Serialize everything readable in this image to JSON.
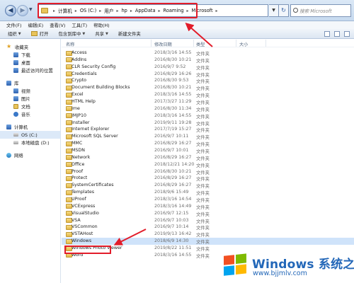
{
  "address": {
    "crumbs": [
      "计算机",
      "OS (C:)",
      "用户",
      "hp",
      "AppData",
      "Roaming",
      "Microsoft"
    ]
  },
  "search": {
    "placeholder": "搜索 Microsoft"
  },
  "menu": [
    "文件(F)",
    "编辑(E)",
    "查看(V)",
    "工具(T)",
    "帮助(H)"
  ],
  "toolbar": {
    "organize": "组织",
    "open": "打开",
    "include": "包含到库中",
    "share": "共享",
    "new_folder": "新建文件夹"
  },
  "nav": {
    "favorites": "收藏夹",
    "downloads": "下载",
    "desktop": "桌面",
    "recent": "最近访问的位置",
    "libraries": "库",
    "videos": "视频",
    "pictures": "图片",
    "documents": "文档",
    "music": "音乐",
    "computer": "计算机",
    "drive_c": "OS (C:)",
    "drive_d": "本地磁盘 (D:)",
    "network": "网络"
  },
  "columns": {
    "name": "名称",
    "date": "修改日期",
    "type": "类型",
    "size": "大小"
  },
  "files": [
    {
      "name": "Access",
      "date": "2018/3/16 14:55",
      "type": "文件夹"
    },
    {
      "name": "AddIns",
      "date": "2016/8/30 10:21",
      "type": "文件夹"
    },
    {
      "name": "CLR Security Config",
      "date": "2016/9/7 9:52",
      "type": "文件夹"
    },
    {
      "name": "Credentials",
      "date": "2016/8/29 16:26",
      "type": "文件夹"
    },
    {
      "name": "Crypto",
      "date": "2016/8/30 9:53",
      "type": "文件夹"
    },
    {
      "name": "Document Building Blocks",
      "date": "2016/8/30 10:21",
      "type": "文件夹"
    },
    {
      "name": "Excel",
      "date": "2018/3/16 14:55",
      "type": "文件夹"
    },
    {
      "name": "HTML Help",
      "date": "2017/3/27 11:29",
      "type": "文件夹"
    },
    {
      "name": "Ime",
      "date": "2016/8/30 11:34",
      "type": "文件夹"
    },
    {
      "name": "IMJP10",
      "date": "2018/3/16 14:55",
      "type": "文件夹"
    },
    {
      "name": "Installer",
      "date": "2019/9/11 19:28",
      "type": "文件夹"
    },
    {
      "name": "Internet Explorer",
      "date": "2017/7/19 15:27",
      "type": "文件夹"
    },
    {
      "name": "Microsoft SQL Server",
      "date": "2016/9/7 10:11",
      "type": "文件夹"
    },
    {
      "name": "MMC",
      "date": "2016/8/29 16:27",
      "type": "文件夹"
    },
    {
      "name": "MSDN",
      "date": "2016/9/7 10:01",
      "type": "文件夹"
    },
    {
      "name": "Network",
      "date": "2016/8/29 16:27",
      "type": "文件夹"
    },
    {
      "name": "Office",
      "date": "2018/12/21 14:20",
      "type": "文件夹"
    },
    {
      "name": "Proof",
      "date": "2016/8/30 10:21",
      "type": "文件夹"
    },
    {
      "name": "Protect",
      "date": "2016/8/29 16:27",
      "type": "文件夹"
    },
    {
      "name": "SystemCertificates",
      "date": "2016/8/29 16:27",
      "type": "文件夹"
    },
    {
      "name": "Templates",
      "date": "2018/9/6 15:49",
      "type": "文件夹"
    },
    {
      "name": "UProof",
      "date": "2018/3/16 14:54",
      "type": "文件夹"
    },
    {
      "name": "VCExpress",
      "date": "2018/3/16 14:49",
      "type": "文件夹"
    },
    {
      "name": "VisualStudio",
      "date": "2016/9/7 12:15",
      "type": "文件夹"
    },
    {
      "name": "VSA",
      "date": "2016/9/7 10:03",
      "type": "文件夹"
    },
    {
      "name": "VSCommon",
      "date": "2016/9/7 10:14",
      "type": "文件夹"
    },
    {
      "name": "VSTAHost",
      "date": "2019/9/13 16:42",
      "type": "文件夹"
    },
    {
      "name": "Windows",
      "date": "2018/6/9 14:30",
      "type": "文件夹",
      "selected": true
    },
    {
      "name": "Windows Photo Viewer",
      "date": "2019/8/22 11:51",
      "type": "文件夹"
    },
    {
      "name": "Word",
      "date": "2018/3/16 14:55",
      "type": "文件夹"
    }
  ],
  "watermark": {
    "title": "Windows 系统之家",
    "url": "www.bjjmlv.com"
  },
  "colors": {
    "highlight": "#e21c2a",
    "accent": "#2367b8"
  }
}
